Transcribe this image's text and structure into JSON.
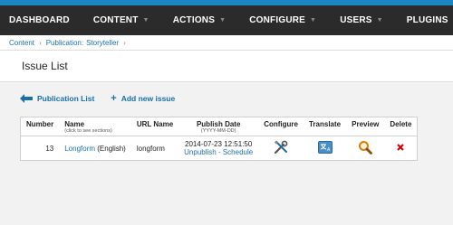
{
  "nav": {
    "items": [
      {
        "label": "DASHBOARD",
        "caret": false
      },
      {
        "label": "CONTENT",
        "caret": true
      },
      {
        "label": "ACTIONS",
        "caret": true
      },
      {
        "label": "CONFIGURE",
        "caret": true
      },
      {
        "label": "USERS",
        "caret": true
      },
      {
        "label": "PLUGINS",
        "caret": true
      }
    ]
  },
  "breadcrumb": {
    "content": "Content",
    "publication_label": "Publication:",
    "publication_value": "Storyteller"
  },
  "page": {
    "title": "Issue List"
  },
  "actions": {
    "publication_list": "Publication List",
    "add_new_issue": "Add new issue"
  },
  "table": {
    "headers": {
      "number": "Number",
      "name": "Name",
      "name_sub": "(click to see sections)",
      "url_name": "URL Name",
      "publish_date": "Publish Date",
      "publish_date_sub": "(YYYY-MM-DD)",
      "configure": "Configure",
      "translate": "Translate",
      "preview": "Preview",
      "delete": "Delete"
    },
    "rows": [
      {
        "number": "13",
        "name_link": "Longform",
        "language": "(English)",
        "url_name": "longform",
        "publish_date": "2014-07-23 12:51:50",
        "unpublish": "Unpublish",
        "dash": " - ",
        "schedule": "Schedule"
      }
    ]
  },
  "colors": {
    "accent_stripe": "#1a85c2",
    "navbar": "#2b2b2b",
    "link": "#1a6fa8",
    "delete": "#cc0000"
  }
}
